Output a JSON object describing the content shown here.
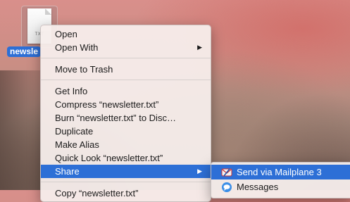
{
  "desktop": {
    "file": {
      "name": "newsletter.txt",
      "name_visible": "newsle",
      "icon_label": "TXT"
    }
  },
  "context_menu": {
    "items": [
      {
        "label": "Open"
      },
      {
        "label": "Open With",
        "has_submenu": true
      },
      {
        "label": "Move to Trash"
      },
      {
        "label": "Get Info"
      },
      {
        "label": "Compress “newsletter.txt”"
      },
      {
        "label": "Burn “newsletter.txt” to Disc…"
      },
      {
        "label": "Duplicate"
      },
      {
        "label": "Make Alias"
      },
      {
        "label": "Quick Look “newsletter.txt”"
      },
      {
        "label": "Share",
        "has_submenu": true,
        "selected": true
      },
      {
        "label": "Copy “newsletter.txt”"
      }
    ],
    "submenu_arrow": "▶"
  },
  "share_submenu": {
    "items": [
      {
        "label": "Send via Mailplane 3",
        "icon": "mailplane-icon",
        "selected": true
      },
      {
        "label": "Messages",
        "icon": "messages-icon"
      }
    ]
  },
  "colors": {
    "selection": "#2d6fd6",
    "menu_bg": "#f6eeec"
  }
}
